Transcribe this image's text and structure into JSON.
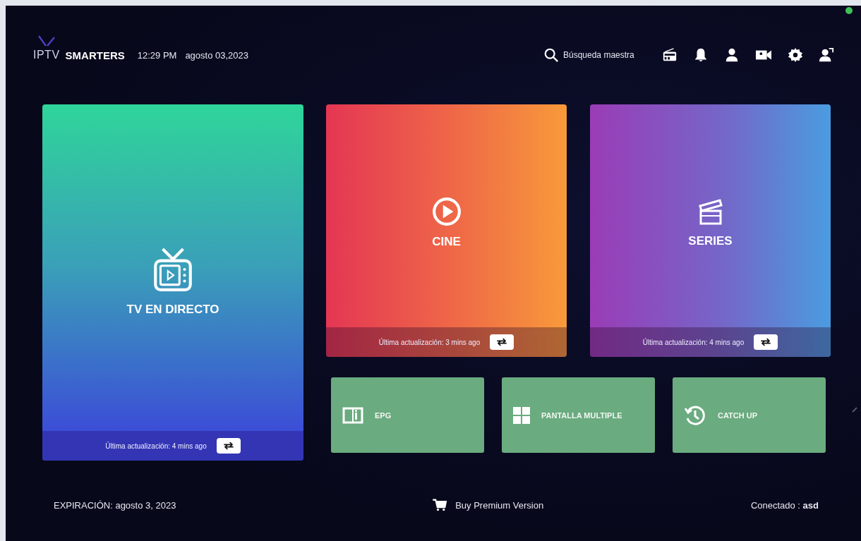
{
  "header": {
    "logo_light": "IPTV",
    "logo_bold": "SMARTERS",
    "time": "12:29 PM",
    "date": "agosto 03,2023",
    "search": {
      "placeholder": "Búsqueda maestra"
    }
  },
  "main_tiles": [
    {
      "kind": "tall",
      "label": "TV EN DIRECTO",
      "update": "Última actualización: 4 mins ago"
    },
    {
      "kind": "wide",
      "label": "CINE",
      "update": "Última actualización: 3 mins ago"
    },
    {
      "kind": "wide",
      "label": "SERIES",
      "update": "Última actualización: 4 mins ago"
    }
  ],
  "small_tiles": [
    {
      "label": "EPG"
    },
    {
      "label": "PANTALLA MULTIPLE"
    },
    {
      "label": "CATCH UP"
    }
  ],
  "footer": {
    "expiration": "EXPIRACIÓN: agosto 3, 2023",
    "premium": "Buy Premium Version",
    "connected": "Conectado : **asd**"
  }
}
